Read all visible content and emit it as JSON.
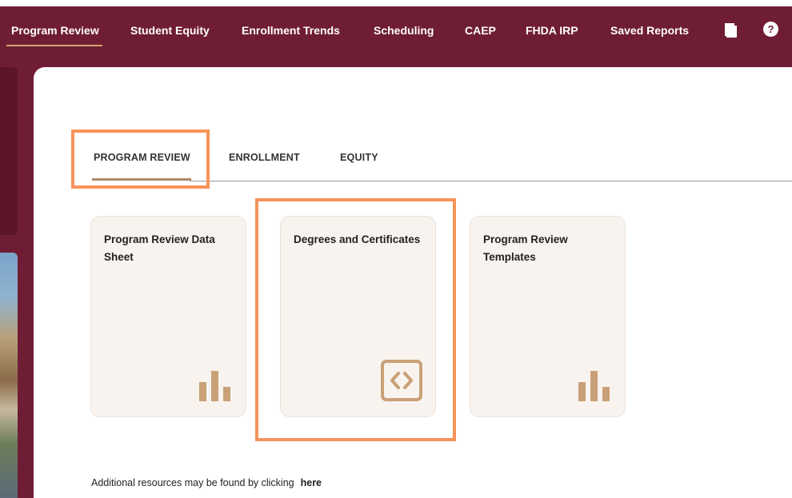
{
  "nav": {
    "items": [
      {
        "label": "Program Review",
        "active": true
      },
      {
        "label": "Student Equity"
      },
      {
        "label": "Enrollment Trends"
      },
      {
        "label": "Scheduling"
      },
      {
        "label": "CAEP"
      },
      {
        "label": "FHDA IRP"
      },
      {
        "label": "Saved Reports"
      }
    ],
    "help_label": "?"
  },
  "tabs": [
    {
      "label": "PROGRAM REVIEW",
      "active": true
    },
    {
      "label": "ENROLLMENT"
    },
    {
      "label": "EQUITY"
    }
  ],
  "cards": [
    {
      "title": "Program Review Data Sheet",
      "icon": "bar-chart-icon"
    },
    {
      "title": "Degrees and Certificates",
      "icon": "code-brackets-icon"
    },
    {
      "title": "Program Review Templates",
      "icon": "bar-chart-icon"
    }
  ],
  "footer": {
    "text": "Additional resources may be found by clicking",
    "link_label": "here"
  },
  "colors": {
    "brand": "#6f1d35",
    "accent": "#c9a077",
    "highlight": "#f7935a",
    "card_bg": "#f8f3ee"
  }
}
